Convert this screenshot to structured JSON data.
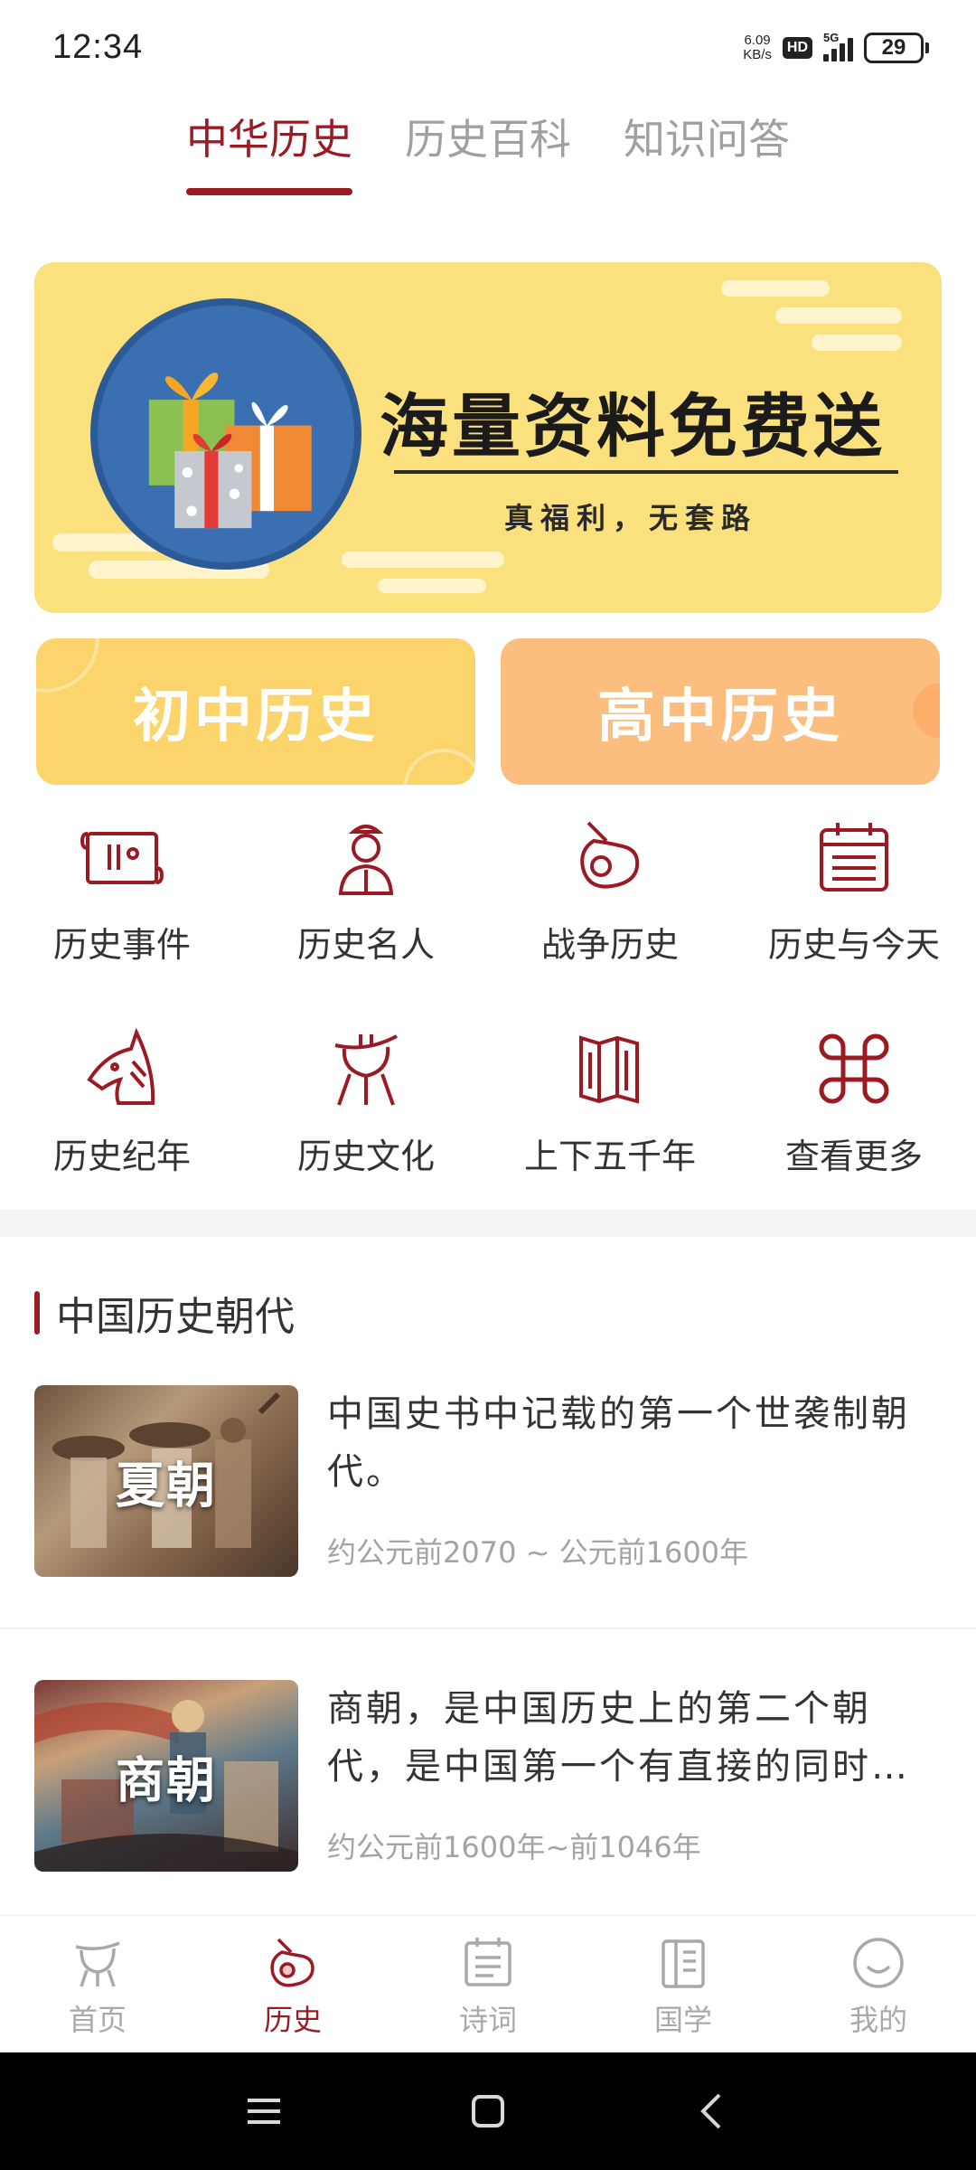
{
  "status_bar": {
    "time": "12:34",
    "net_speed_value": "6.09",
    "net_speed_unit": "KB/s",
    "hd_label": "HD",
    "network": "5G",
    "battery": "29"
  },
  "tabs": [
    {
      "label": "中华历史",
      "active": true
    },
    {
      "label": "历史百科",
      "active": false
    },
    {
      "label": "知识问答",
      "active": false
    }
  ],
  "banner": {
    "title": "海量资料免费送",
    "subtitle": "真福利，无套路",
    "icon": "gift-boxes"
  },
  "levels": {
    "junior": "初中历史",
    "senior": "高中历史"
  },
  "grid": [
    {
      "label": "历史事件",
      "icon": "scroll-icon"
    },
    {
      "label": "历史名人",
      "icon": "person-icon"
    },
    {
      "label": "战争历史",
      "icon": "battle-icon"
    },
    {
      "label": "历史与今天",
      "icon": "calendar-icon"
    },
    {
      "label": "历史纪年",
      "icon": "horse-icon"
    },
    {
      "label": "历史文化",
      "icon": "bronze-vessel-icon"
    },
    {
      "label": "上下五千年",
      "icon": "map-icon"
    },
    {
      "label": "查看更多",
      "icon": "command-icon"
    }
  ],
  "section": {
    "title": "中国历史朝代"
  },
  "dynasties": [
    {
      "name": "夏朝",
      "desc": "中国史书中记载的第一个世袭制朝代。",
      "period": "约公元前2070 ~ 公元前1600年"
    },
    {
      "name": "商朝",
      "desc": "商朝，是中国历史上的第二个朝代，是中国第一个有直接的同时…",
      "period": "约公元前1600年~前1046年"
    }
  ],
  "bottom_nav": [
    {
      "label": "首页",
      "icon": "home-vessel-icon",
      "active": false
    },
    {
      "label": "历史",
      "icon": "history-icon",
      "active": true
    },
    {
      "label": "诗词",
      "icon": "poetry-icon",
      "active": false
    },
    {
      "label": "国学",
      "icon": "book-icon",
      "active": false
    },
    {
      "label": "我的",
      "icon": "profile-icon",
      "active": false
    }
  ],
  "colors": {
    "accent": "#9b1b24",
    "banner_bg": "#fbe17e",
    "junior_bg": "#fbd46c",
    "senior_bg": "#fcbe7e"
  }
}
